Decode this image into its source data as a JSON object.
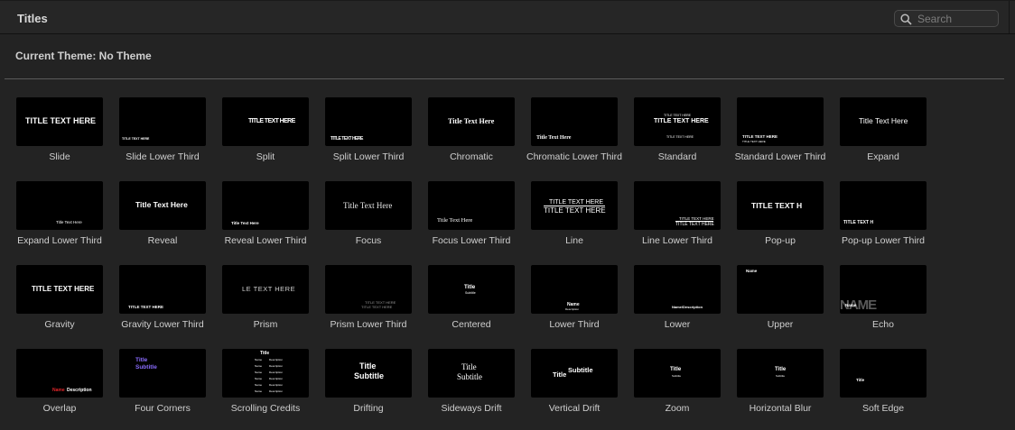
{
  "header": {
    "title": "Titles"
  },
  "search": {
    "placeholder": "Search"
  },
  "theme": {
    "label": "Current Theme: No Theme"
  },
  "titles": [
    {
      "name": "Slide",
      "preview": "TITLE TEXT HERE"
    },
    {
      "name": "Slide Lower Third",
      "preview": "TITLE TEXT HERE"
    },
    {
      "name": "Split",
      "preview": "TITLE TEXT HERE"
    },
    {
      "name": "Split Lower Third",
      "preview": "TITLE TEXT HERE"
    },
    {
      "name": "Chromatic",
      "preview": "Title Text Here"
    },
    {
      "name": "Chromatic Lower Third",
      "preview": "Title Text Here"
    },
    {
      "name": "Standard",
      "preview": "TITLE TEXT HERE"
    },
    {
      "name": "Standard Lower Third",
      "preview": "TITLE TEXT HERE"
    },
    {
      "name": "Expand",
      "preview": "Title Text Here"
    },
    {
      "name": "Expand Lower Third",
      "preview": "Title Text Here"
    },
    {
      "name": "Reveal",
      "preview": "Title Text Here"
    },
    {
      "name": "Reveal Lower Third",
      "preview": "Title Text Here"
    },
    {
      "name": "Focus",
      "preview": "Title Text Here"
    },
    {
      "name": "Focus Lower Third",
      "preview": "Title Text Here"
    },
    {
      "name": "Line",
      "preview": "TITLE TEXT HERE"
    },
    {
      "name": "Line Lower Third",
      "preview": "TITLE TEXT HERE"
    },
    {
      "name": "Pop-up",
      "preview": "TITLE TEXT H"
    },
    {
      "name": "Pop-up Lower Third",
      "preview": "TITLE TEXT H"
    },
    {
      "name": "Gravity",
      "preview": "TITLE TEXT HERE"
    },
    {
      "name": "Gravity Lower Third",
      "preview": "TITLE TEXT HERE"
    },
    {
      "name": "Prism",
      "preview": "LE TEXT HERE"
    },
    {
      "name": "Prism Lower Third",
      "preview": "TITLE TEXT HERE"
    },
    {
      "name": "Centered",
      "preview": "Title"
    },
    {
      "name": "Lower Third",
      "preview": "Name"
    },
    {
      "name": "Lower",
      "preview": "Name/Description"
    },
    {
      "name": "Upper",
      "preview": "Name"
    },
    {
      "name": "Echo",
      "preview": "NAME"
    },
    {
      "name": "Overlap",
      "preview": "Description"
    },
    {
      "name": "Four Corners",
      "preview": "Title"
    },
    {
      "name": "Scrolling Credits",
      "preview": "Title"
    },
    {
      "name": "Drifting",
      "preview": "Title"
    },
    {
      "name": "Sideways Drift",
      "preview": "Title"
    },
    {
      "name": "Vertical Drift",
      "preview": "Title"
    },
    {
      "name": "Zoom",
      "preview": "Title"
    },
    {
      "name": "Horizontal Blur",
      "preview": "Title"
    },
    {
      "name": "Soft Edge",
      "preview": "Title"
    }
  ],
  "preview_subs": {
    "subtitle": "Subtitle",
    "name": "Name",
    "description": "Description"
  },
  "colors": {
    "background": "#232323",
    "accent_purple": "#8a6cff",
    "accent_red": "#e0262a"
  }
}
